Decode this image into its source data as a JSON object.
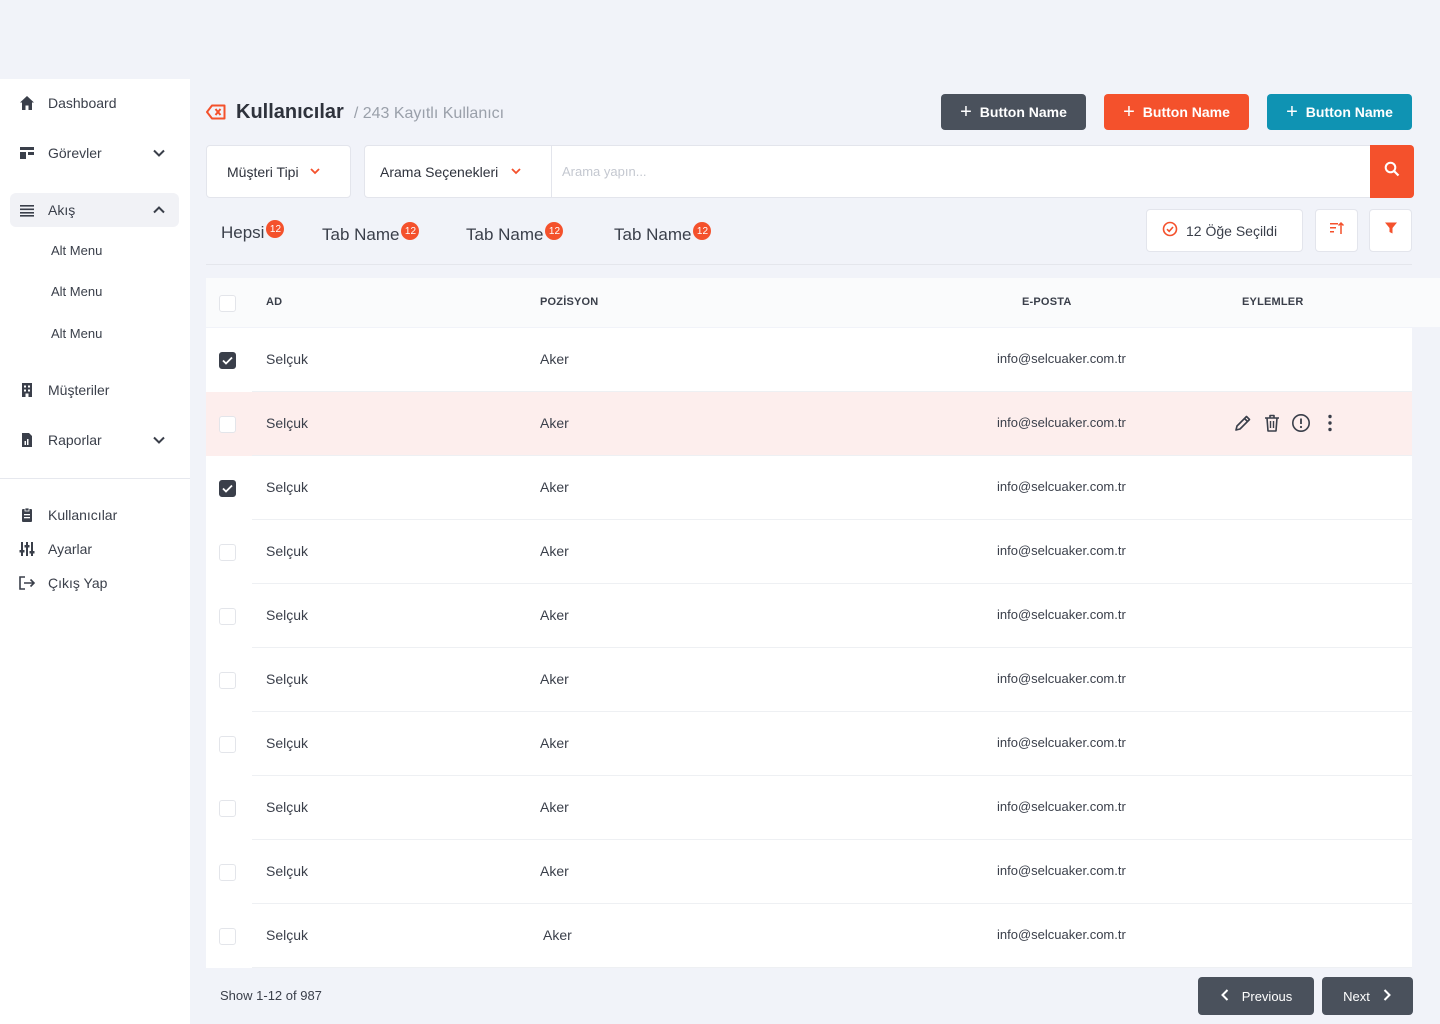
{
  "sidebar": {
    "items": [
      {
        "label": "Dashboard",
        "icon": "home-icon"
      },
      {
        "label": "Görevler",
        "icon": "tasks-icon"
      },
      {
        "label": "Akış",
        "icon": "list-icon"
      },
      {
        "label": "Müşteriler",
        "icon": "building-icon"
      },
      {
        "label": "Raporlar",
        "icon": "report-icon"
      }
    ],
    "sub_items": [
      "Alt Menu",
      "Alt Menu",
      "Alt Menu"
    ],
    "bottom_items": [
      {
        "label": "Kullanıcılar",
        "icon": "clipboard-icon"
      },
      {
        "label": "Ayarlar",
        "icon": "sliders-icon"
      },
      {
        "label": "Çıkış Yap",
        "icon": "logout-icon"
      }
    ]
  },
  "header": {
    "title": "Kullanıcılar",
    "subtitle": "/ 243 Kayıtlı Kullanıcı",
    "buttons": [
      {
        "label": "Button Name",
        "color": "#4a515c"
      },
      {
        "label": "Button Name",
        "color": "#f4512c"
      },
      {
        "label": "Button Name",
        "color": "#0f93b3"
      }
    ]
  },
  "filters": {
    "customer_type": "Müşteri Tipi",
    "search_options": "Arama Seçenekleri",
    "search_placeholder": "Arama yapın..."
  },
  "tabs": [
    {
      "label": "Hepsi",
      "count": "12"
    },
    {
      "label": "Tab Name",
      "count": "12"
    },
    {
      "label": "Tab Name",
      "count": "12"
    },
    {
      "label": "Tab Name",
      "count": "12"
    }
  ],
  "selection": {
    "label": "12 Öğe Seçildi"
  },
  "table": {
    "headers": {
      "name": "AD",
      "position": "POZİSYON",
      "email": "E-POSTA",
      "actions": "EYLEMLER"
    },
    "rows": [
      {
        "name": "Selçuk",
        "position": "Aker",
        "email": "info@selcuaker.com.tr",
        "checked": true
      },
      {
        "name": "Selçuk",
        "position": "Aker",
        "email": "info@selcuaker.com.tr",
        "checked": false
      },
      {
        "name": "Selçuk",
        "position": "Aker",
        "email": "info@selcuaker.com.tr",
        "checked": true
      },
      {
        "name": "Selçuk",
        "position": "Aker",
        "email": "info@selcuaker.com.tr",
        "checked": false
      },
      {
        "name": "Selçuk",
        "position": "Aker",
        "email": "info@selcuaker.com.tr",
        "checked": false
      },
      {
        "name": "Selçuk",
        "position": "Aker",
        "email": "info@selcuaker.com.tr",
        "checked": false
      },
      {
        "name": "Selçuk",
        "position": "Aker",
        "email": "info@selcuaker.com.tr",
        "checked": false
      },
      {
        "name": "Selçuk",
        "position": "Aker",
        "email": "info@selcuaker.com.tr",
        "checked": false
      },
      {
        "name": "Selçuk",
        "position": "Aker",
        "email": "info@selcuaker.com.tr",
        "checked": false
      },
      {
        "name": "Selçuk",
        "position": "Aker",
        "email": "info@selcuaker.com.tr",
        "checked": false
      }
    ]
  },
  "pagination": {
    "summary": "Show 1-12 of 987",
    "previous": "Previous",
    "next": "Next"
  },
  "colors": {
    "accent": "#f4512c",
    "dark": "#4a515c",
    "teal": "#0f93b3",
    "highlight_row": "#fdeeed"
  }
}
